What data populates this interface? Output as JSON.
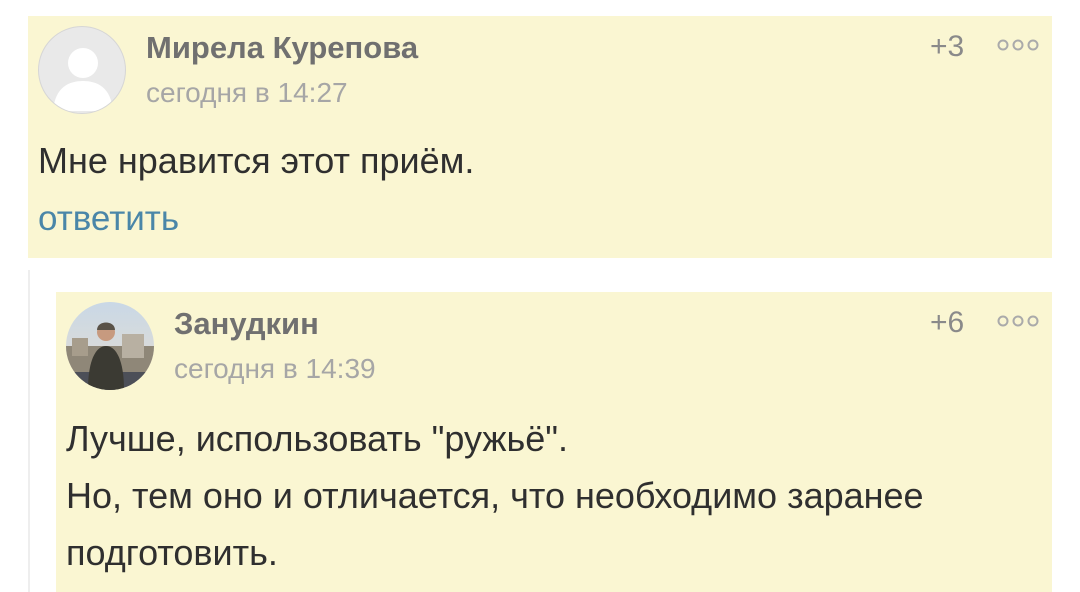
{
  "comments": [
    {
      "author": "Мирела Курепова",
      "date": "сегодня в 14:27",
      "score": "+3",
      "text": "Мне нравится этот приём.",
      "reply_label": "ответить",
      "avatar_icon": "default-user-avatar",
      "more_icon": "more-options-icon"
    },
    {
      "author": "Занудкин",
      "date": "сегодня в 14:39",
      "score": "+6",
      "text_lines": [
        "Лучше, использовать \"ружьё\".",
        "Но, тем оно и отличается, что необходимо заранее",
        "подготовить."
      ],
      "avatar_icon": "user-photo-avatar",
      "more_icon": "more-options-icon"
    }
  ],
  "colors": {
    "comment_bg": "#faf6d2",
    "reply_link": "#4a86a8",
    "author": "#707070",
    "date": "#a6a6a6"
  }
}
